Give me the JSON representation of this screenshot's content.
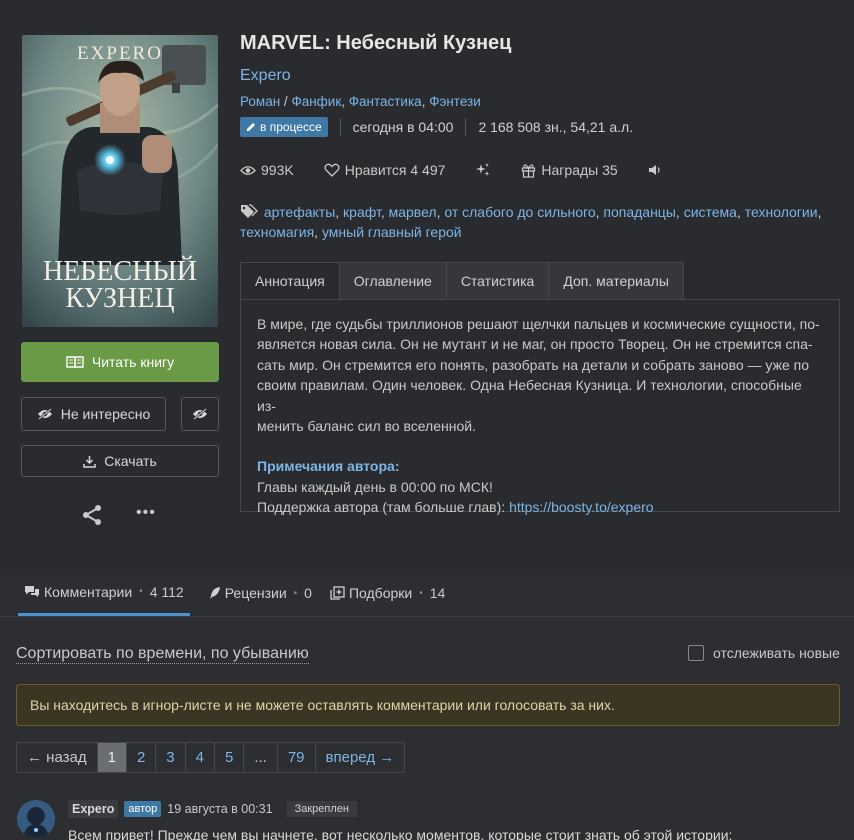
{
  "book": {
    "title": "MARVEL: Небесный Кузнец",
    "author": "Expero",
    "form": "Роман",
    "genres": [
      "Фанфик",
      "Фантастика",
      "Фэнтези"
    ],
    "status": "в процессе",
    "updated": "сегодня в 04:00",
    "size": "2 168 508 зн., 54,21 а.л.",
    "cover": {
      "author_text": "EXPERO",
      "title_line1": "НЕБЕСНЫЙ",
      "title_line2": "КУЗНЕЦ"
    }
  },
  "stats": {
    "views": "993K",
    "likes": "Нравится 4 497",
    "awards": "Награды 35"
  },
  "tags": [
    "артефакты",
    "крафт",
    "марвел",
    "от слабого до сильного",
    "попаданцы",
    "система",
    "технологии",
    "техномагия",
    "умный главный герой"
  ],
  "actions": {
    "read": "Читать книгу",
    "not_interested": "Не интересно",
    "download": "Скачать"
  },
  "tabs": [
    "Аннотация",
    "Оглавление",
    "Статистика",
    "Доп. материалы"
  ],
  "annotation": {
    "line1": "В мире, где судьбы триллионов решают щелчки пальцев и космические сущности, по-",
    "line2": "является новая сила. Он не мутант и не маг, он просто Творец. Он не стремится спа-",
    "line3": "сать мир. Он стремится его понять, разобрать на детали и собрать заново — уже по",
    "line4": "своим правилам. Один человек. Одна Небесная Кузница. И технологии, способные из-",
    "line5": "менить баланс сил во вселенной.",
    "notes_title": "Примечания автора:",
    "note1": "Главы каждый день в 00:00 по МСК!",
    "note2_prefix": "Поддержка автора (там больше глав): ",
    "note2_link": "https://boosty.to/expero"
  },
  "comments_tabs": {
    "comments": {
      "label": "Комментарии",
      "count": "4 112"
    },
    "reviews": {
      "label": "Рецензии",
      "count": "0"
    },
    "collections": {
      "label": "Подборки",
      "count": "14"
    }
  },
  "sort_label": "Сортировать по времени, по убыванию",
  "track_label": "отслеживать новые",
  "warning": "Вы находитесь в игнор-листе и не можете оставлять комментарии или голосовать за них.",
  "pager": {
    "prev": "← назад",
    "pages": [
      "1",
      "2",
      "3",
      "4",
      "5",
      "...",
      "79"
    ],
    "next": "вперед →"
  },
  "comment": {
    "author": "Expero",
    "badge": "автор",
    "date": "19 августа в 00:31",
    "pinned": "Закреплен",
    "text": "Всем привет! Прежде чем вы начнете, вот несколько моментов, которые стоит знать об этой истории:"
  },
  "colors": {
    "background": "#2a2b2e",
    "link": "#7cb5e6",
    "read_button": "#6a9a45",
    "status_badge": "#3f78a5",
    "warning_bg": "#3b3624"
  }
}
